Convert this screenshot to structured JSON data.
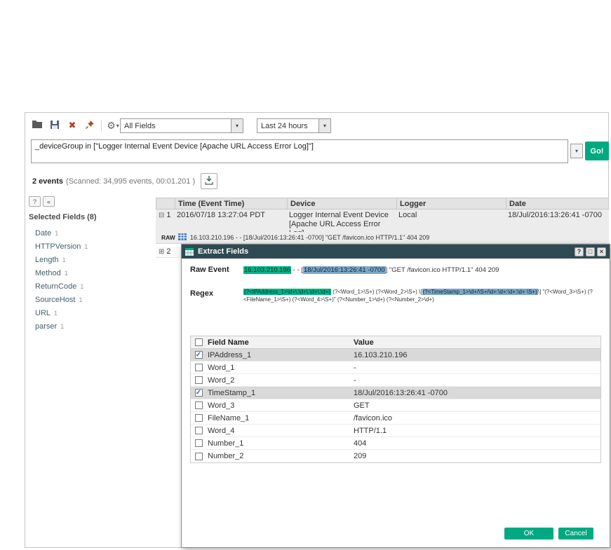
{
  "colors": {
    "accent": "#01A982",
    "dialog_title_bg": "#2E4A52",
    "highlight_green": "#00B388",
    "highlight_blue": "#7BA7C7"
  },
  "icons": {
    "delete": "✖",
    "gear": "⚙",
    "check": "✔",
    "dropdown_arrow": "▾",
    "collapse_row": "⊟",
    "expand_row": "⊞",
    "help": "?",
    "collapse_panel": "«",
    "dialog_help": "?",
    "dialog_minimize": "□",
    "dialog_close": "×"
  },
  "toolbar": {
    "fields_dropdown": "All Fields",
    "time_dropdown": "Last 24 hours"
  },
  "search": {
    "query": "_deviceGroup in [\"Logger Internal Event Device [Apache URL Access Error Log]\"]",
    "go_label": "Go!"
  },
  "summary": {
    "events": "2 events",
    "scanned": "(Scanned: 34,995 events,  00:01.201 )"
  },
  "sidebar": {
    "title": "Selected Fields (8)",
    "items": [
      {
        "label": "Date",
        "count": "1"
      },
      {
        "label": "HTTPVersion",
        "count": "1"
      },
      {
        "label": "Length",
        "count": "1"
      },
      {
        "label": "Method",
        "count": "1"
      },
      {
        "label": "ReturnCode",
        "count": "1"
      },
      {
        "label": "SourceHost",
        "count": "1"
      },
      {
        "label": "URL",
        "count": "1"
      },
      {
        "label": "parser",
        "count": "1"
      }
    ]
  },
  "results": {
    "columns": [
      "Time (Event Time)",
      "Device",
      "Logger",
      "Date"
    ],
    "row1": {
      "num": "1",
      "time": "2016/07/18 13:27:04 PDT",
      "device_line1": "Logger Internal Event Device",
      "device_line2": "[Apache URL Access Error Log]",
      "logger": "Local",
      "date": "18/Jul/2016:13:26:41 -0700"
    },
    "raw_label": "RAW",
    "raw_text": "16.103.210.196 - - [18/Jul/2016:13:26:41 -0700] \"GET /favicon.ico HTTP/1.1\" 404 209",
    "row2": {
      "num": "2"
    }
  },
  "dialog": {
    "title": "Extract Fields",
    "raw_event_label": "Raw Event",
    "raw_event": {
      "ip": "16.103.210.196",
      "sep": " - - [",
      "timestamp": "18/Jul/2016:13:26:41 -0700",
      "rest": "] \"GET /favicon.ico HTTP/1.1\" 404 209"
    },
    "regex_label": "Regex",
    "regex": {
      "ip": "(?<IPAddress_1>\\d+\\.\\d+\\.\\d+\\.\\d+)",
      "mid": " (?<Word_1>\\S+) (?<Word_2>\\S+) \\[",
      "timestamp": "(?<TimeStamp_1>\\d+/\\S+/\\d+:\\d+:\\d+:\\d+ \\S+)",
      "rest": "\\] \"(?<Word_3>\\S+) (?<FileName_1>\\S+) (?<Word_4>\\S+)\" (?<Number_1>\\d+) (?<Number_2>\\d+)"
    },
    "columns": [
      "Field Name",
      "Value"
    ],
    "rows": [
      {
        "checked": true,
        "field": "IPAddress_1",
        "value": "16.103.210.196"
      },
      {
        "checked": false,
        "field": "Word_1",
        "value": "-"
      },
      {
        "checked": false,
        "field": "Word_2",
        "value": "-"
      },
      {
        "checked": true,
        "field": "TimeStamp_1",
        "value": "18/Jul/2016:13:26:41 -0700"
      },
      {
        "checked": false,
        "field": "Word_3",
        "value": "GET"
      },
      {
        "checked": false,
        "field": "FileName_1",
        "value": "/favicon.ico"
      },
      {
        "checked": false,
        "field": "Word_4",
        "value": "HTTP/1.1"
      },
      {
        "checked": false,
        "field": "Number_1",
        "value": "404"
      },
      {
        "checked": false,
        "field": "Number_2",
        "value": "209"
      }
    ],
    "ok_label": "OK",
    "cancel_label": "Cancel"
  }
}
